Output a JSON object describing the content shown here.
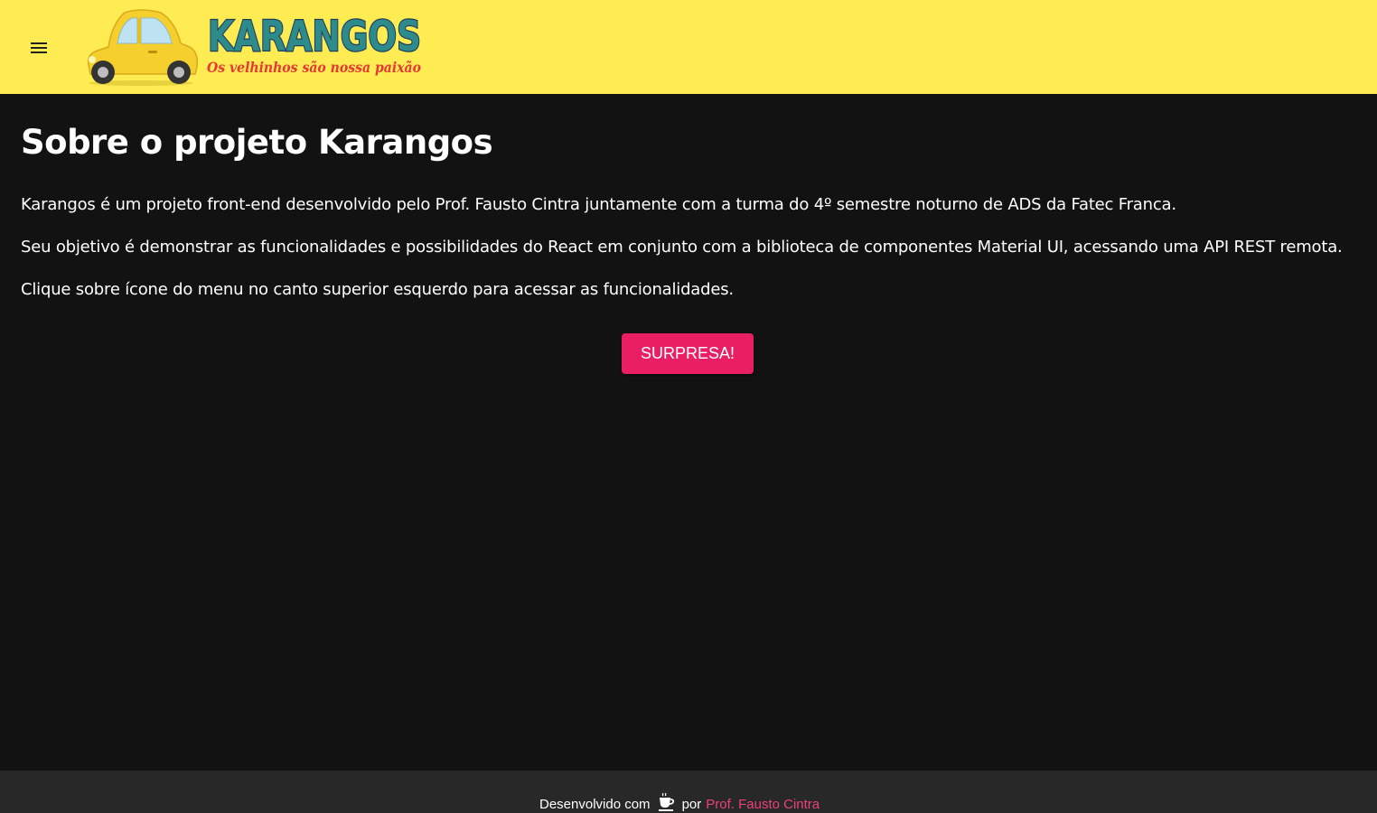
{
  "app_bar": {
    "background": "#ffeb52",
    "menu_icon": "hamburger-menu-icon",
    "logo": {
      "brand": "KARANGOS",
      "tagline": "Os velhinhos são nossa paixão"
    }
  },
  "main": {
    "title": "Sobre o projeto Karangos",
    "paragraphs": [
      "Karangos é um projeto front-end desenvolvido pelo Prof. Fausto Cintra juntamente com a turma do 4º semestre noturno de ADS da Fatec Franca.",
      "Seu objetivo é demonstrar as funcionalidades e possibilidades do React em conjunto com a biblioteca de componentes Material UI, acessando uma API REST remota.",
      "Clique sobre ícone do menu no canto superior esquerdo para acessar as funcionalidades."
    ],
    "surprise_button": "SURPRESA!",
    "button_color": "#e91e63"
  },
  "footer": {
    "prefix": "Desenvolvido com",
    "icon": "coffee-icon",
    "by": "por",
    "author": "Prof. Fausto Cintra",
    "author_color": "#ec407a"
  }
}
